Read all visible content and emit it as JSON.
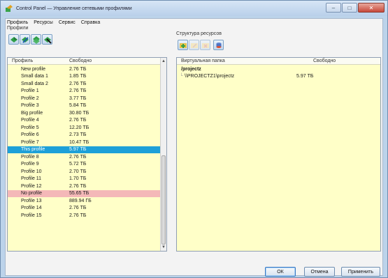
{
  "window": {
    "title": "Control Panel — Управление сетевыми профилями",
    "minimize_glyph": "–",
    "maximize_glyph": "□",
    "close_glyph": "✕"
  },
  "menu": [
    "Профиль",
    "Ресурсы",
    "Сервис",
    "Справка"
  ],
  "profiles": {
    "group_label": "Профили",
    "columns": {
      "name": "Профиль",
      "free": "Свободно"
    },
    "rows": [
      {
        "name": "New profile",
        "free": "2.76 ТБ",
        "state": "normal"
      },
      {
        "name": "Small data 1",
        "free": "1.85 ТБ",
        "state": "normal"
      },
      {
        "name": "Small data 2",
        "free": "2.76 ТБ",
        "state": "normal"
      },
      {
        "name": "Profile 1",
        "free": "2.76 ТБ",
        "state": "normal"
      },
      {
        "name": "Profile 2",
        "free": "3.77 ТБ",
        "state": "normal"
      },
      {
        "name": "Profile 3",
        "free": "5.84 ТБ",
        "state": "normal"
      },
      {
        "name": "Big profile",
        "free": "30.80 ТБ",
        "state": "normal"
      },
      {
        "name": "Profile 4",
        "free": "2.76 ТБ",
        "state": "normal"
      },
      {
        "name": "Profile 5",
        "free": "12.20 ТБ",
        "state": "normal"
      },
      {
        "name": "Profile 6",
        "free": "2.73 ТБ",
        "state": "normal"
      },
      {
        "name": "Profile 7",
        "free": "10.47 ТБ",
        "state": "normal"
      },
      {
        "name": "This profile",
        "free": "5.97 ТБ",
        "state": "selected"
      },
      {
        "name": "Profile 8",
        "free": "2.76 ТБ",
        "state": "normal"
      },
      {
        "name": "Profile 9",
        "free": "5.72 ТБ",
        "state": "normal"
      },
      {
        "name": "Profile 10",
        "free": "2.70 ТБ",
        "state": "normal"
      },
      {
        "name": "Profile 11",
        "free": "1.70 ТБ",
        "state": "normal"
      },
      {
        "name": "Profile 12",
        "free": "2.76 ТБ",
        "state": "normal"
      },
      {
        "name": "No profile",
        "free": "55.65 ТБ",
        "state": "error"
      },
      {
        "name": "Profile 13",
        "free": "889.94 ГБ",
        "state": "normal"
      },
      {
        "name": "Profile 14",
        "free": "2.76 ТБ",
        "state": "normal"
      },
      {
        "name": "Profile 15",
        "free": "2.76 ТБ",
        "state": "normal"
      }
    ],
    "scroll_up_glyph": "▲",
    "scroll_down_glyph": "▼"
  },
  "resources": {
    "group_label": "Структура ресурсов",
    "columns": {
      "folder": "Виртуальная папка",
      "free": "Свободно"
    },
    "root": "/projectz",
    "items": [
      {
        "path": "\\\\PROJECTZ1\\projectz",
        "free": "5.97 ТБ"
      }
    ]
  },
  "buttons": {
    "ok": "ОК",
    "cancel": "Отмена",
    "apply": "Применить"
  },
  "colors": {
    "list_background": "#ffffc8",
    "selection": "#1ea0d8",
    "error_row": "#f4b8b8",
    "window_frame": "#bcd3ea"
  }
}
